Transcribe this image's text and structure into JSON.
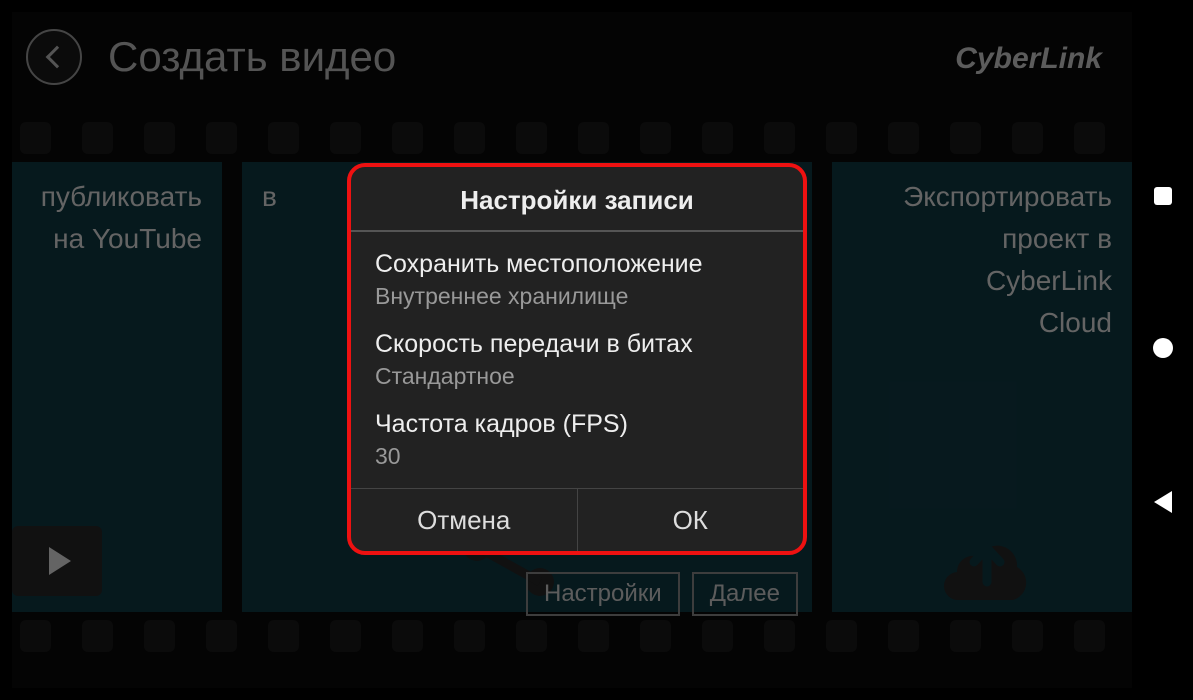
{
  "header": {
    "title": "Создать видео",
    "brand": "CyberLink"
  },
  "cards": {
    "youtube": "публиковать\nна YouTube",
    "middle_prefix": "в",
    "cloud": "Экспортировать\nпроект в\nCyberLink\nCloud"
  },
  "buttons": {
    "settings": "Настройки",
    "next": "Далее"
  },
  "dialog": {
    "title": "Настройки записи",
    "rows": [
      {
        "label": "Сохранить местоположение",
        "value": "Внутреннее хранилище"
      },
      {
        "label": "Скорость передачи в битах",
        "value": "Стандартное"
      },
      {
        "label": "Частота кадров (FPS)",
        "value": "30"
      }
    ],
    "cancel": "Отмена",
    "ok": "ОК"
  }
}
